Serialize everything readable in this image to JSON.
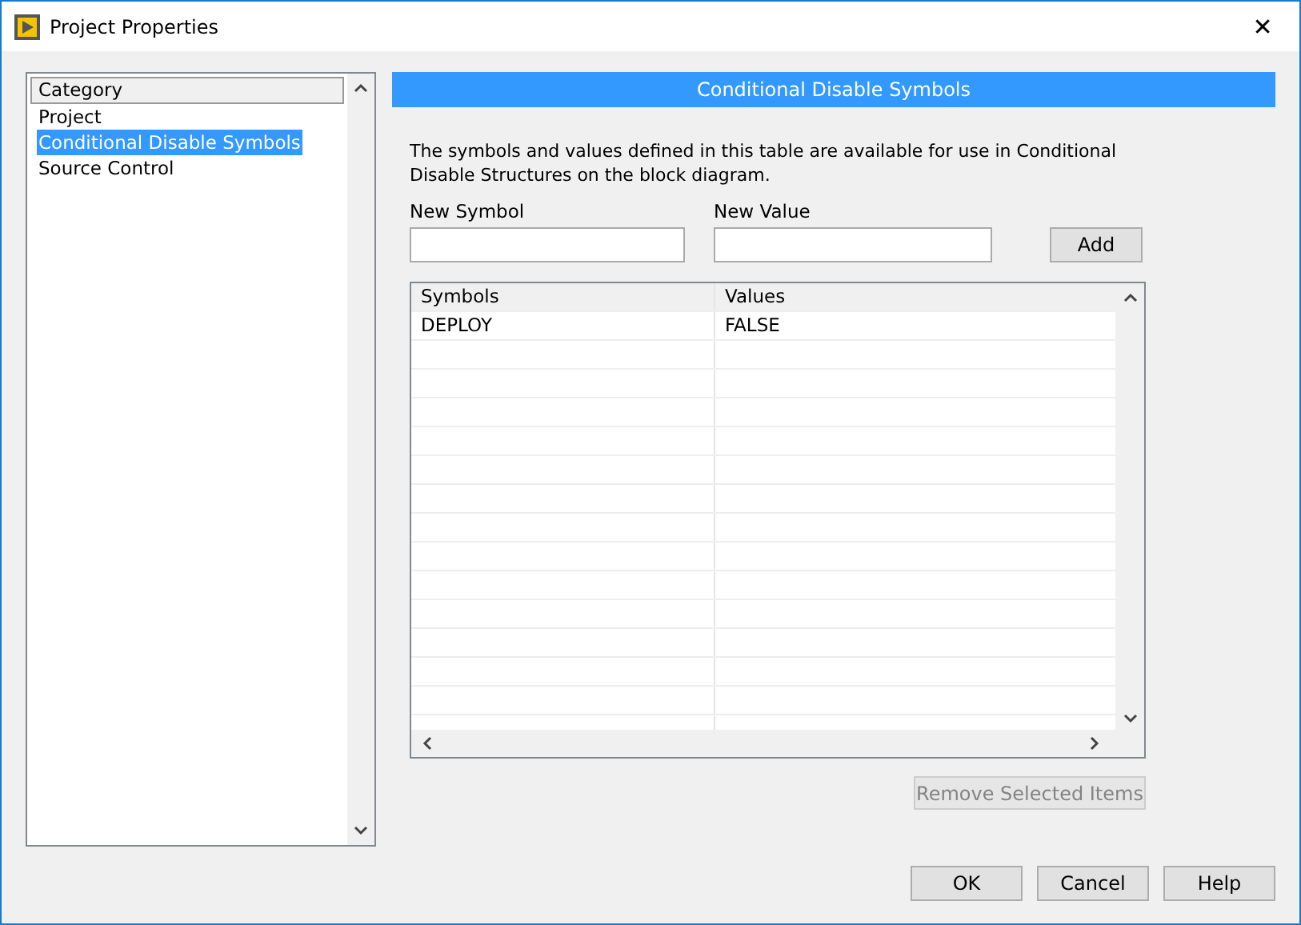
{
  "window": {
    "title": "Project Properties",
    "close": "✕"
  },
  "category": {
    "header": "Category",
    "items": [
      {
        "label": "Project",
        "selected": false
      },
      {
        "label": "Conditional Disable Symbols",
        "selected": true
      },
      {
        "label": "Source Control",
        "selected": false
      }
    ]
  },
  "panel": {
    "title": "Conditional Disable Symbols",
    "description": "The symbols and values defined in this table are available for use in Conditional Disable Structures on the block diagram.",
    "new_symbol": {
      "label": "New Symbol"
    },
    "new_value": {
      "label": "New Value"
    },
    "add_button": "Add",
    "table": {
      "columns": [
        "Symbols",
        "Values"
      ],
      "rows": [
        [
          "DEPLOY",
          "FALSE"
        ]
      ]
    },
    "remove_button": {
      "label": "Remove Selected Items",
      "disabled": true
    }
  },
  "buttons": [
    "OK",
    "Cancel",
    "Help"
  ]
}
